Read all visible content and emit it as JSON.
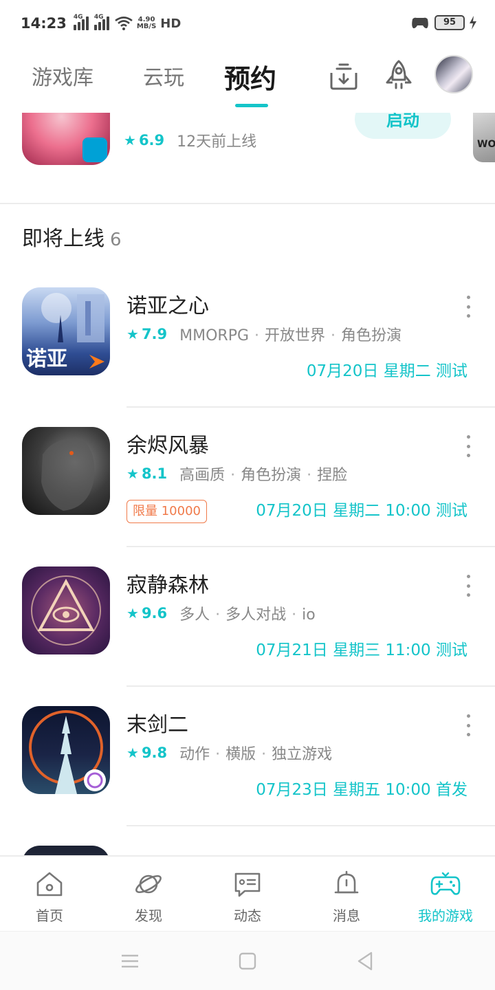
{
  "status_bar": {
    "time": "14:23",
    "network1": "4G",
    "network2": "4G",
    "speed_value": "4.90",
    "speed_unit": "MB/S",
    "hd": "HD",
    "battery": "95"
  },
  "top_nav": {
    "tabs": [
      {
        "label": "游戏库"
      },
      {
        "label": "云玩"
      },
      {
        "label": "预约"
      }
    ],
    "active_tab": "预约"
  },
  "partial_game": {
    "rating": "6.9",
    "meta": "12天前上线",
    "button": "启动",
    "next_game_text": "WOT"
  },
  "section": {
    "title": "即将上线",
    "count": "6"
  },
  "games": [
    {
      "title": "诺亚之心",
      "rating": "7.9",
      "tags": [
        "MMORPG",
        "开放世界",
        "角色扮演"
      ],
      "date": "07月20日 星期二 测试",
      "icon_text": "诺亚"
    },
    {
      "title": "余烬风暴",
      "rating": "8.1",
      "tags": [
        "高画质",
        "角色扮演",
        "捏脸"
      ],
      "date": "07月20日 星期二 10:00 测试",
      "limit": "限量 10000"
    },
    {
      "title": "寂静森林",
      "rating": "9.6",
      "tags": [
        "多人",
        "多人对战",
        "io"
      ],
      "date": "07月21日 星期三 11:00 测试"
    },
    {
      "title": "末剑二",
      "rating": "9.8",
      "tags": [
        "动作",
        "横版",
        "独立游戏"
      ],
      "date": "07月23日 星期五 10:00 首发"
    }
  ],
  "bottom_nav": {
    "items": [
      {
        "label": "首页",
        "icon": "home-icon"
      },
      {
        "label": "发现",
        "icon": "planet-icon"
      },
      {
        "label": "动态",
        "icon": "chat-icon"
      },
      {
        "label": "消息",
        "icon": "bell-icon"
      },
      {
        "label": "我的游戏",
        "icon": "gamepad-icon"
      }
    ],
    "active": "我的游戏"
  },
  "colors": {
    "accent": "#14c4c9",
    "limit": "#f07a4a",
    "text": "#222222",
    "muted": "#888888"
  }
}
